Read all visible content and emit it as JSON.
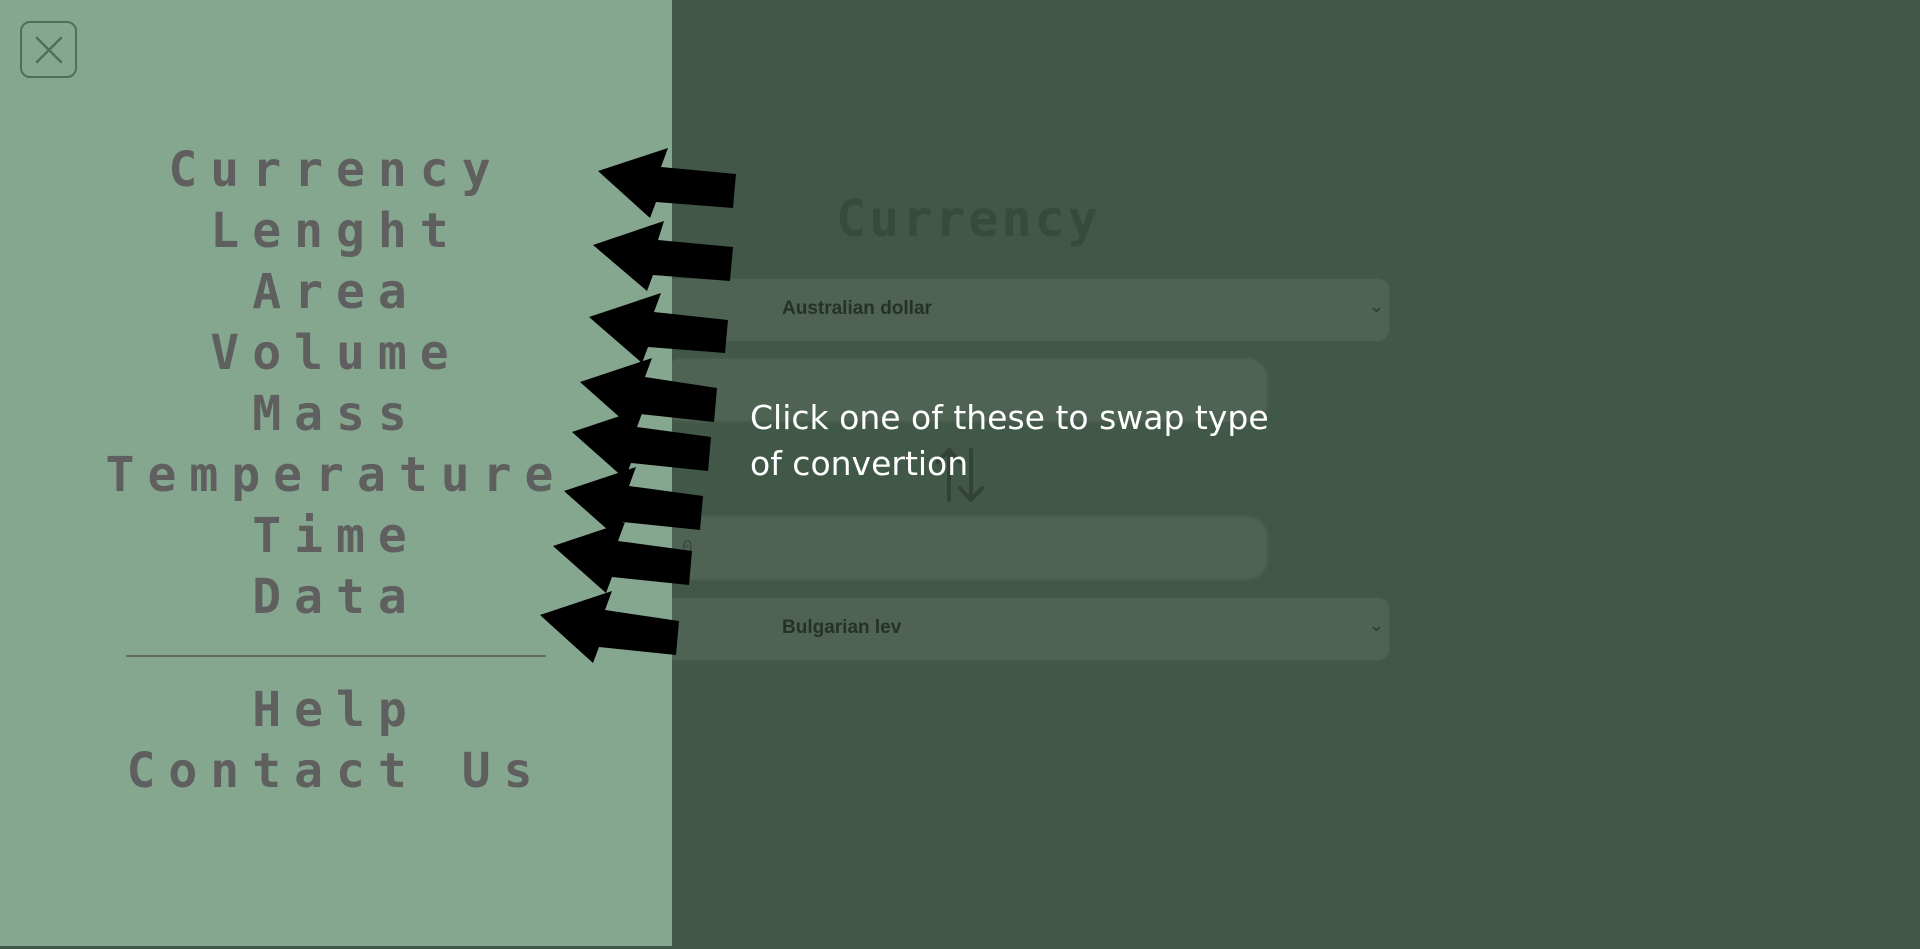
{
  "converter": {
    "title": "Currency",
    "from_select": {
      "value": "Australian dollar"
    },
    "to_select": {
      "value": "Bulgarian lev"
    },
    "from_input": {
      "value": ""
    },
    "to_input": {
      "value": "0"
    }
  },
  "side_menu": {
    "items": [
      {
        "label": "Currency"
      },
      {
        "label": "Lenght"
      },
      {
        "label": "Area"
      },
      {
        "label": "Volume"
      },
      {
        "label": "Mass"
      },
      {
        "label": "Temperature"
      },
      {
        "label": "Time"
      },
      {
        "label": "Data"
      }
    ],
    "secondary_items": [
      {
        "label": "Help"
      },
      {
        "label": "Contact Us"
      }
    ]
  },
  "tutorial": {
    "tip_text": "Click one of these to swap type of convertion"
  },
  "icons": {
    "close": "close-icon",
    "swap": "swap-arrows-icon",
    "dropdown": "chevron-down-icon",
    "pointer": "tutorial-arrow-icon"
  },
  "colors": {
    "page_background": "#415848",
    "menu_background": "#86a78f",
    "menu_text": "#5f5f5f",
    "tip_text": "#ffffff",
    "arrow": "#000000"
  }
}
